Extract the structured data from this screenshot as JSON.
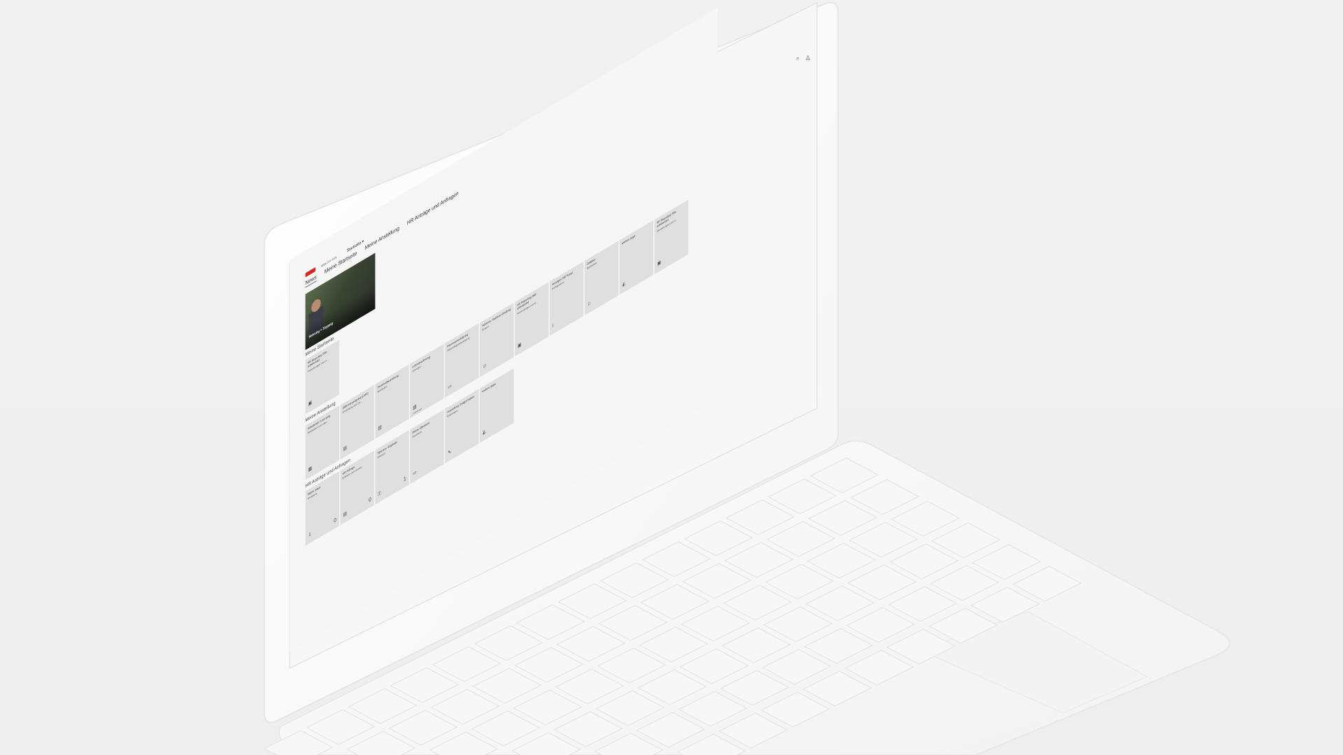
{
  "shell": {
    "logo_text": "SBB CFF FFS",
    "home_label": "Startseite ▾",
    "search_icon": "search-icon",
    "user_icon": "user-icon"
  },
  "anchor_bar": {
    "tabs": [
      {
        "label": "News",
        "active": true
      },
      {
        "label": "Meine Startseite",
        "active": false
      },
      {
        "label": "Meine Anstellung",
        "active": false
      },
      {
        "label": "HR Anträge und Anfragen",
        "active": false
      }
    ]
  },
  "news": {
    "caption": "Störung + Zugang"
  },
  "sections": {
    "startseite": {
      "title": "Meine Startseite",
      "tiles": [
        {
          "title": "HR Reporting (Mit-arbeitende)",
          "sub": "Auswertungen und U...",
          "icon": "▣",
          "icon_name": "report-icon",
          "count": "",
          "foot": ""
        }
      ]
    },
    "anstellung": {
      "title": "Meine Anstellung",
      "tiles": [
        {
          "title": "Arbeitszeit / Leis-tung",
          "sub": "Bearbeiten und erfas...",
          "icon": "▦",
          "icon_name": "calendar-icon",
          "count": "",
          "foot": ""
        },
        {
          "title": "SBB Kursangebot (LMS)",
          "sub": "Anmeldung und Dur...",
          "icon": "▤",
          "icon_name": "course-icon",
          "count": "",
          "foot": ""
        },
        {
          "title": "Personalbeurteilung",
          "sub": "Bearbeiten",
          "icon": "▥",
          "icon_name": "clipboard-icon",
          "count": "",
          "foot": ""
        },
        {
          "title": "Lohnabrechnung",
          "sub": "Anzeigen",
          "icon": "▧",
          "icon_name": "payslip-icon",
          "count": "",
          "foot": "Vorbesuch"
        },
        {
          "title": "Interessenerklärung",
          "sub": "Nebentätigkeitserklärung",
          "icon": "▭",
          "icon_name": "form-icon",
          "count": "",
          "foot": ""
        },
        {
          "title": "Adresse / Bankver-bindung",
          "sub": "Ändern",
          "icon": "☺",
          "icon_name": "person-icon",
          "count": "",
          "foot": ""
        },
        {
          "title": "HR Reporting (Mit-arbeitende)",
          "sub": "Auswertungen und U...",
          "icon": "▣",
          "icon_name": "report-icon",
          "count": "",
          "foot": ""
        },
        {
          "title": "Anzeigen HR Portal",
          "sub": "Konfigurieren",
          "icon": "i",
          "icon_name": "info-icon",
          "count": "",
          "foot": ""
        },
        {
          "title": "Zielplan",
          "sub": "Bearbeiten",
          "icon": "⚐",
          "icon_name": "target-icon",
          "count": "",
          "foot": ""
        },
        {
          "title": "weitere Apps",
          "sub": "",
          "icon": "◭",
          "icon_name": "apps-icon",
          "count": "",
          "foot": ""
        },
        {
          "title": "HR Reporting (Mit-arbeitende)",
          "sub": "Auswertungen und U...",
          "icon": "▣",
          "icon_name": "report-icon",
          "count": "",
          "foot": ""
        }
      ]
    },
    "antraege": {
      "title": "HR Anträge und Anfragen",
      "tiles": [
        {
          "title": "Meine Inbox",
          "sub": "Workitems",
          "icon": "⇩",
          "icon_name": "inbox-icon",
          "count": "0",
          "foot": ""
        },
        {
          "title": "HR Anfrage",
          "sub": "Erfassen und verwalt...",
          "icon": "▤",
          "icon_name": "request-icon",
          "count": "0",
          "foot": ""
        },
        {
          "title": "Sperren / Zugänge",
          "sub": "Erfassen",
          "icon": "⚿",
          "icon_name": "access-icon",
          "count": "1",
          "foot": ""
        },
        {
          "title": "Meine Übersicht",
          "sub": "Workitems",
          "icon": "▭",
          "icon_name": "overview-icon",
          "count": "",
          "foot": ""
        },
        {
          "title": "Auszeitung Zeitgut-haben",
          "sub": "Beantragen",
          "icon": "✎",
          "icon_name": "edit-icon",
          "count": "",
          "foot": ""
        },
        {
          "title": "weitere Apps",
          "sub": "",
          "icon": "◭",
          "icon_name": "apps-icon",
          "count": "",
          "foot": ""
        }
      ]
    }
  }
}
